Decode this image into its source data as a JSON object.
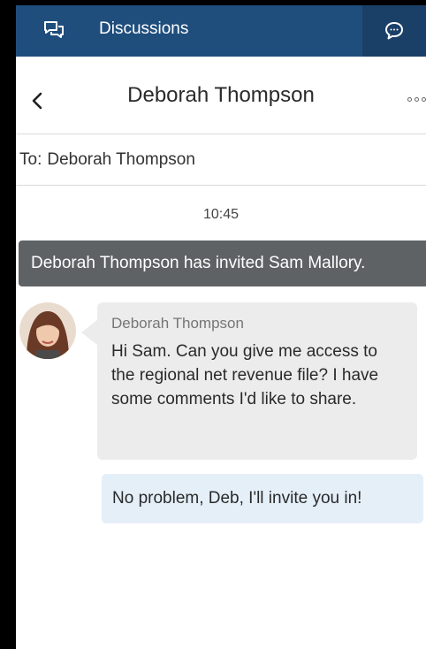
{
  "topbar": {
    "title": "Discussions",
    "icon": "chat-bubbles-icon",
    "chat_button_icon": "chat-bubble-icon",
    "color": "#1f4e7d"
  },
  "header": {
    "title": "Deborah Thompson",
    "back_icon": "chevron-left-icon",
    "more_icon": "more-options-icon"
  },
  "to": {
    "label": "To:",
    "value": "Deborah Thompson"
  },
  "messages": {
    "time": "10:45",
    "system": "Deborah Thompson has invited Sam Mallory.",
    "incoming": {
      "sender": "Deborah Thompson",
      "text": "Hi Sam. Can you give me access to the regional net revenue file? I have some comments I'd like to share."
    },
    "outgoing": {
      "text": "No problem, Deb, I'll invite you in!"
    }
  }
}
